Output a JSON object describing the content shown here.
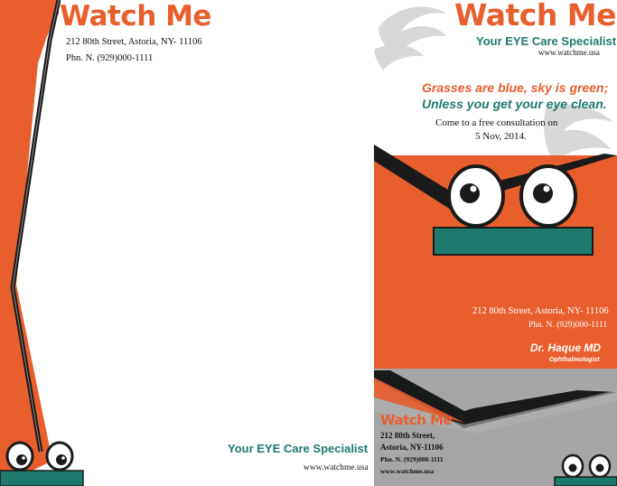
{
  "left_page": {
    "brand": "Watch Me",
    "address": "212 80th Street, Astoria, NY- 11106",
    "phone": "Phn. N. (929)000-1111",
    "tagline": "Your EYE Care Specialist",
    "website": "www.watchme.usa"
  },
  "right_page": {
    "brand": "Watch Me",
    "tagline": "Your EYE Care Specialist",
    "website": "www.watchme.usa",
    "slogan_line1": "Grasses are blue, sky is green;",
    "slogan_line2": "Unless you get your eye clean.",
    "consult_line1": "Come to a free consultation on",
    "consult_line2": "5 Nov, 2014.",
    "address": "212 80th Street, Astoria, NY- 11106",
    "phone": "Phn. N. (929)000-1111",
    "doctor_name": "Dr. Haque MD",
    "doctor_title": "Ophthalmologist"
  },
  "business_card": {
    "brand": "Watch Me",
    "address_line1": "212 80th Street,",
    "address_line2": "Astoria, NY-11106",
    "phone": "Phn. N. (929)000-1111",
    "website": "www.watchme.usa"
  },
  "colors": {
    "orange": "#e85e2c",
    "teal": "#1f7a6e",
    "gray": "#a6a6a6",
    "black": "#1a1a1a",
    "light_gray_swirl": "#c8c8c8"
  }
}
